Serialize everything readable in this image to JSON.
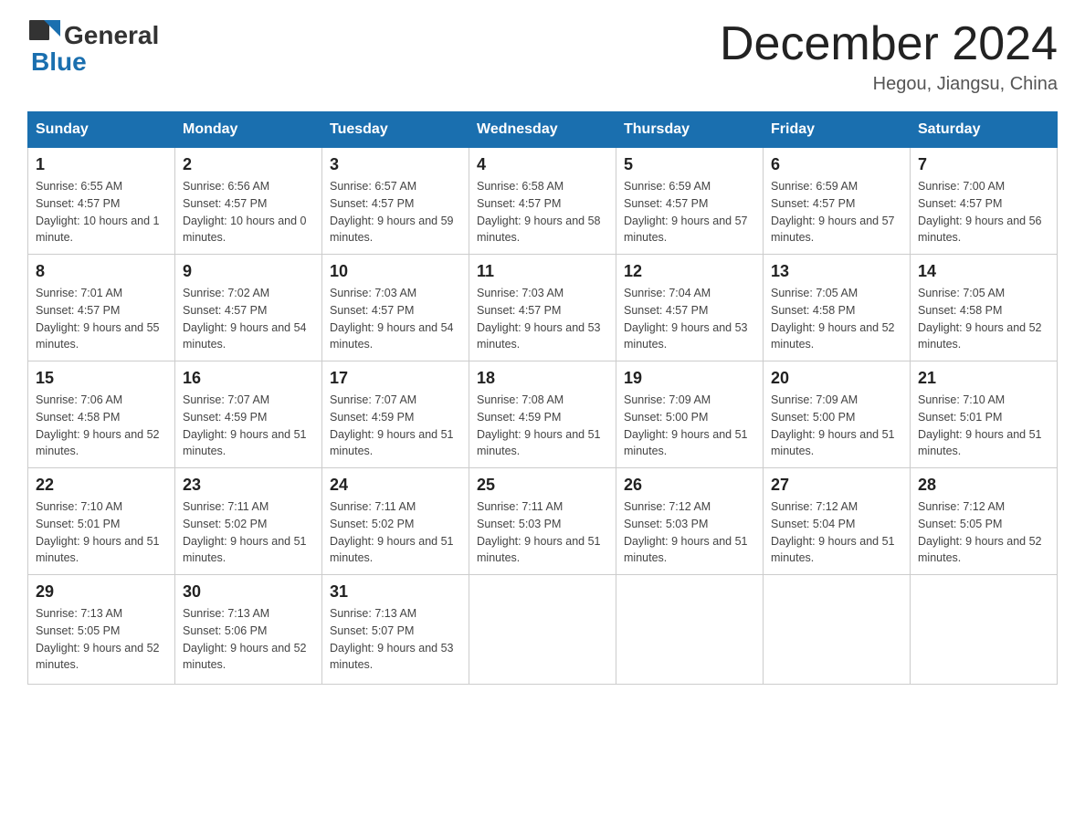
{
  "header": {
    "logo_general": "General",
    "logo_blue": "Blue",
    "month_title": "December 2024",
    "subtitle": "Hegou, Jiangsu, China"
  },
  "days_of_week": [
    "Sunday",
    "Monday",
    "Tuesday",
    "Wednesday",
    "Thursday",
    "Friday",
    "Saturday"
  ],
  "weeks": [
    [
      {
        "day": "1",
        "sunrise": "6:55 AM",
        "sunset": "4:57 PM",
        "daylight": "10 hours and 1 minute."
      },
      {
        "day": "2",
        "sunrise": "6:56 AM",
        "sunset": "4:57 PM",
        "daylight": "10 hours and 0 minutes."
      },
      {
        "day": "3",
        "sunrise": "6:57 AM",
        "sunset": "4:57 PM",
        "daylight": "9 hours and 59 minutes."
      },
      {
        "day": "4",
        "sunrise": "6:58 AM",
        "sunset": "4:57 PM",
        "daylight": "9 hours and 58 minutes."
      },
      {
        "day": "5",
        "sunrise": "6:59 AM",
        "sunset": "4:57 PM",
        "daylight": "9 hours and 57 minutes."
      },
      {
        "day": "6",
        "sunrise": "6:59 AM",
        "sunset": "4:57 PM",
        "daylight": "9 hours and 57 minutes."
      },
      {
        "day": "7",
        "sunrise": "7:00 AM",
        "sunset": "4:57 PM",
        "daylight": "9 hours and 56 minutes."
      }
    ],
    [
      {
        "day": "8",
        "sunrise": "7:01 AM",
        "sunset": "4:57 PM",
        "daylight": "9 hours and 55 minutes."
      },
      {
        "day": "9",
        "sunrise": "7:02 AM",
        "sunset": "4:57 PM",
        "daylight": "9 hours and 54 minutes."
      },
      {
        "day": "10",
        "sunrise": "7:03 AM",
        "sunset": "4:57 PM",
        "daylight": "9 hours and 54 minutes."
      },
      {
        "day": "11",
        "sunrise": "7:03 AM",
        "sunset": "4:57 PM",
        "daylight": "9 hours and 53 minutes."
      },
      {
        "day": "12",
        "sunrise": "7:04 AM",
        "sunset": "4:57 PM",
        "daylight": "9 hours and 53 minutes."
      },
      {
        "day": "13",
        "sunrise": "7:05 AM",
        "sunset": "4:58 PM",
        "daylight": "9 hours and 52 minutes."
      },
      {
        "day": "14",
        "sunrise": "7:05 AM",
        "sunset": "4:58 PM",
        "daylight": "9 hours and 52 minutes."
      }
    ],
    [
      {
        "day": "15",
        "sunrise": "7:06 AM",
        "sunset": "4:58 PM",
        "daylight": "9 hours and 52 minutes."
      },
      {
        "day": "16",
        "sunrise": "7:07 AM",
        "sunset": "4:59 PM",
        "daylight": "9 hours and 51 minutes."
      },
      {
        "day": "17",
        "sunrise": "7:07 AM",
        "sunset": "4:59 PM",
        "daylight": "9 hours and 51 minutes."
      },
      {
        "day": "18",
        "sunrise": "7:08 AM",
        "sunset": "4:59 PM",
        "daylight": "9 hours and 51 minutes."
      },
      {
        "day": "19",
        "sunrise": "7:09 AM",
        "sunset": "5:00 PM",
        "daylight": "9 hours and 51 minutes."
      },
      {
        "day": "20",
        "sunrise": "7:09 AM",
        "sunset": "5:00 PM",
        "daylight": "9 hours and 51 minutes."
      },
      {
        "day": "21",
        "sunrise": "7:10 AM",
        "sunset": "5:01 PM",
        "daylight": "9 hours and 51 minutes."
      }
    ],
    [
      {
        "day": "22",
        "sunrise": "7:10 AM",
        "sunset": "5:01 PM",
        "daylight": "9 hours and 51 minutes."
      },
      {
        "day": "23",
        "sunrise": "7:11 AM",
        "sunset": "5:02 PM",
        "daylight": "9 hours and 51 minutes."
      },
      {
        "day": "24",
        "sunrise": "7:11 AM",
        "sunset": "5:02 PM",
        "daylight": "9 hours and 51 minutes."
      },
      {
        "day": "25",
        "sunrise": "7:11 AM",
        "sunset": "5:03 PM",
        "daylight": "9 hours and 51 minutes."
      },
      {
        "day": "26",
        "sunrise": "7:12 AM",
        "sunset": "5:03 PM",
        "daylight": "9 hours and 51 minutes."
      },
      {
        "day": "27",
        "sunrise": "7:12 AM",
        "sunset": "5:04 PM",
        "daylight": "9 hours and 51 minutes."
      },
      {
        "day": "28",
        "sunrise": "7:12 AM",
        "sunset": "5:05 PM",
        "daylight": "9 hours and 52 minutes."
      }
    ],
    [
      {
        "day": "29",
        "sunrise": "7:13 AM",
        "sunset": "5:05 PM",
        "daylight": "9 hours and 52 minutes."
      },
      {
        "day": "30",
        "sunrise": "7:13 AM",
        "sunset": "5:06 PM",
        "daylight": "9 hours and 52 minutes."
      },
      {
        "day": "31",
        "sunrise": "7:13 AM",
        "sunset": "5:07 PM",
        "daylight": "9 hours and 53 minutes."
      },
      null,
      null,
      null,
      null
    ]
  ]
}
